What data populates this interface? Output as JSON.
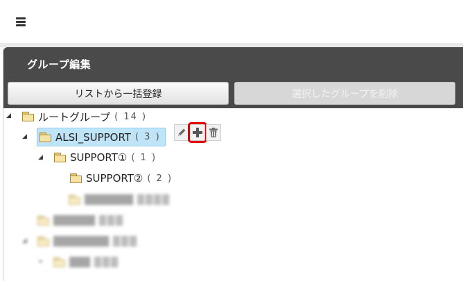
{
  "topbar": {
    "menu_icon": "hamburger-icon"
  },
  "panel": {
    "title": "グループ編集",
    "bulk_register_label": "リストから一括登録",
    "delete_selected_label": "選択したグループを削除"
  },
  "tree": {
    "root": {
      "label": "ルートグループ",
      "count": "( 14 )"
    },
    "alsi": {
      "label": "ALSI_SUPPORT",
      "count": "( 3 )"
    },
    "support1": {
      "label": "SUPPORT①",
      "count": "( 1 )"
    },
    "support2": {
      "label": "SUPPORT②",
      "count": "( 2 )"
    }
  },
  "actions": {
    "edit_icon": "pencil-icon",
    "add_icon": "plus-icon",
    "delete_icon": "trash-icon"
  },
  "colors": {
    "header_bg": "#4a4a4a",
    "selected_bg": "#bfe3f7",
    "highlight_outline": "#e00000",
    "folder_fill": "#f7e3a3"
  }
}
